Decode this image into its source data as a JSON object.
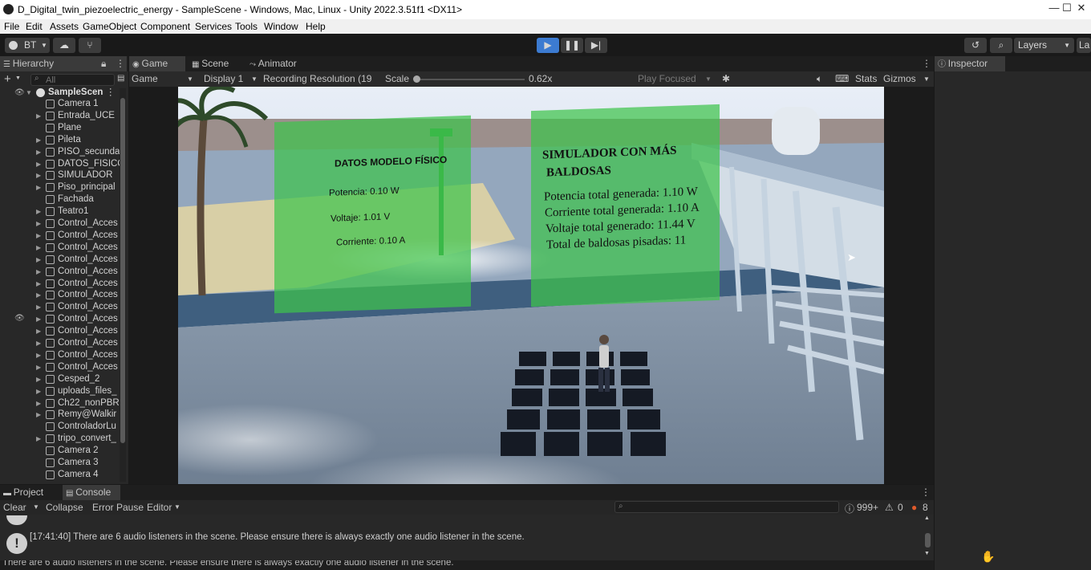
{
  "window": {
    "title": "D_Digital_twin_piezoelectric_energy - SampleScene - Windows, Mac, Linux - Unity 2022.3.51f1 <DX11>",
    "minimize": "—",
    "maximize": "☐",
    "close": "✕"
  },
  "menu": [
    "File",
    "Edit",
    "Assets",
    "GameObject",
    "Component",
    "Services",
    "Tools",
    "Window",
    "Help"
  ],
  "toolbar": {
    "account_label": "BT",
    "layers_label": "Layers",
    "layout_label": "La"
  },
  "hierarchy": {
    "tab": "Hierarchy",
    "search_placeholder": "All",
    "scene_name": "SampleScen",
    "items": [
      {
        "label": "Camera 1",
        "arrow": false
      },
      {
        "label": "Entrada_UCE",
        "arrow": true
      },
      {
        "label": "Plane",
        "arrow": false
      },
      {
        "label": "Pileta",
        "arrow": true
      },
      {
        "label": "PISO_secunda",
        "arrow": true
      },
      {
        "label": "DATOS_FISICO",
        "arrow": true
      },
      {
        "label": "SIMULADOR",
        "arrow": true
      },
      {
        "label": "Piso_principal",
        "arrow": true
      },
      {
        "label": "Fachada",
        "arrow": false
      },
      {
        "label": "Teatro1",
        "arrow": true
      },
      {
        "label": "Control_Acces",
        "arrow": true
      },
      {
        "label": "Control_Acces",
        "arrow": true
      },
      {
        "label": "Control_Acces",
        "arrow": true
      },
      {
        "label": "Control_Acces",
        "arrow": true
      },
      {
        "label": "Control_Acces",
        "arrow": true
      },
      {
        "label": "Control_Acces",
        "arrow": true
      },
      {
        "label": "Control_Acces",
        "arrow": true
      },
      {
        "label": "Control_Acces",
        "arrow": true
      },
      {
        "label": "Control_Acces",
        "arrow": true
      },
      {
        "label": "Control_Acces",
        "arrow": true
      },
      {
        "label": "Control_Acces",
        "arrow": true
      },
      {
        "label": "Control_Acces",
        "arrow": true
      },
      {
        "label": "Control_Acces",
        "arrow": true
      },
      {
        "label": "Cesped_2",
        "arrow": true
      },
      {
        "label": "uploads_files_",
        "arrow": true
      },
      {
        "label": "Ch22_nonPBR",
        "arrow": true
      },
      {
        "label": "Remy@Walkir",
        "arrow": true
      },
      {
        "label": "ControladorLu",
        "arrow": false
      },
      {
        "label": "tripo_convert_",
        "arrow": true
      },
      {
        "label": "Camera 2",
        "arrow": false
      },
      {
        "label": "Camera 3",
        "arrow": false
      },
      {
        "label": "Camera 4",
        "arrow": false
      }
    ]
  },
  "center_tabs": {
    "game": "Game",
    "scene": "Scene",
    "animator": "Animator"
  },
  "game_toolbar": {
    "mode": "Game",
    "display": "Display 1",
    "resolution": "Recording Resolution (19",
    "scale_label": "Scale",
    "scale_value": "0.62x",
    "play_focused": "Play Focused",
    "stats": "Stats",
    "gizmos": "Gizmos"
  },
  "scene_overlay": {
    "panel_physical": {
      "title": "DATOS MODELO FÍSICO",
      "lines": [
        "Potencia: 0.10 W",
        "Voltaje: 1.01 V",
        "Corriente: 0.10 A"
      ]
    },
    "panel_simulator": {
      "title_line1": "SIMULADOR CON MÁS",
      "title_line2": "BALDOSAS",
      "lines": [
        "Potencia total generada: 1.10 W",
        "Corriente total generada: 1.10 A",
        "Voltaje total generado: 11.44 V",
        "Total de baldosas pisadas: 11"
      ]
    }
  },
  "inspector": {
    "tab": "Inspector"
  },
  "console": {
    "tab_project": "Project",
    "tab_console": "Console",
    "clear": "Clear",
    "collapse": "Collapse",
    "error_pause": "Error Pause",
    "editor": "Editor",
    "count_info": "999+",
    "count_warn": "0",
    "count_error": "8",
    "log_line": "[17:41:40] There are 6 audio listeners in the scene. Please ensure there is always exactly one audio listener in the scene.",
    "status_line": "There are 6 audio listeners in the scene. Please ensure there is always exactly one audio listener in the scene."
  },
  "colors": {
    "accent": "#3c7bd1",
    "panel": "#282828",
    "green_panel": "#3fc44c",
    "error": "#e05a2b"
  }
}
